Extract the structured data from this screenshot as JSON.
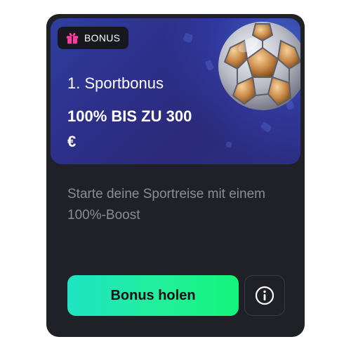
{
  "badge": {
    "label": "BONUS",
    "icon": "gift-icon",
    "icon_color": "#ff3ea5"
  },
  "promo": {
    "subtitle": "1. Sportbonus",
    "headline": "100% BIS ZU 300 €",
    "image": "soccer-ball"
  },
  "description": "Starte deine Sportreise mit einem 100%-Boost",
  "actions": {
    "cta_label": "Bonus holen",
    "info_icon": "info-icon"
  },
  "colors": {
    "card_background": "#202027",
    "hero_gradient": "#2f3f9e",
    "cta_gradient_start": "#1fe3c4",
    "cta_gradient_end": "#12f47a"
  }
}
